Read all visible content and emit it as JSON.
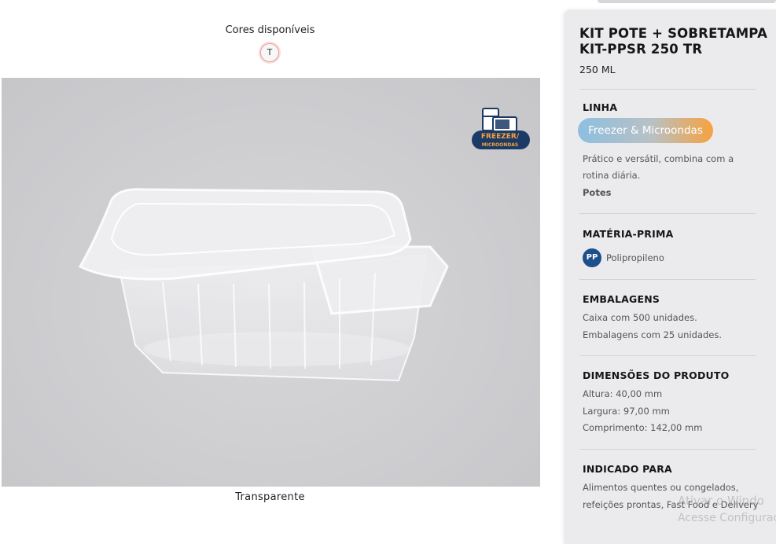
{
  "colors": {
    "title": "Cores disponíveis",
    "swatch_label": "T",
    "selected_name": "Transparente"
  },
  "badge": {
    "line1": "FREEZER/",
    "line2": "MICROONDAS",
    "icons": [
      "fridge-icon",
      "microwave-icon"
    ]
  },
  "product": {
    "title": "KIT POTE + SOBRETAMPA KIT-PPSR 250 TR",
    "volume": "250 ML"
  },
  "sections": {
    "linha": {
      "heading": "LINHA",
      "pill": "Freezer & Microondas",
      "description_1": "Prático e versátil, combina com a",
      "description_2": "rotina diária.",
      "category": "Potes"
    },
    "materia": {
      "heading": "MATÉRIA-PRIMA",
      "badge": "PP",
      "label": "Polipropileno"
    },
    "embalagens": {
      "heading": "EMBALAGENS",
      "line1": "Caixa com 500 unidades.",
      "line2": "Embalagens com 25 unidades."
    },
    "dimensoes": {
      "heading": "DIMENSÕES DO PRODUTO",
      "altura": "Altura: 40,00 mm",
      "largura": "Largura: 97,00 mm",
      "comprimento": "Comprimento: 142,00 mm"
    },
    "indicado": {
      "heading": "INDICADO PARA",
      "line1": "Alimentos quentes ou congelados,",
      "line2": "refeições prontas, Fast Food e Delivery"
    }
  },
  "watermark": {
    "line1": "Ativar o Windo",
    "line2": "Acesse Configuraç"
  },
  "theme": {
    "badge_navy": "#1b3a66",
    "pill_from": "#8dbfe0",
    "pill_to": "#f6a23e",
    "pp_blue": "#1d4f8c",
    "panel_bg": "#ebebed"
  }
}
